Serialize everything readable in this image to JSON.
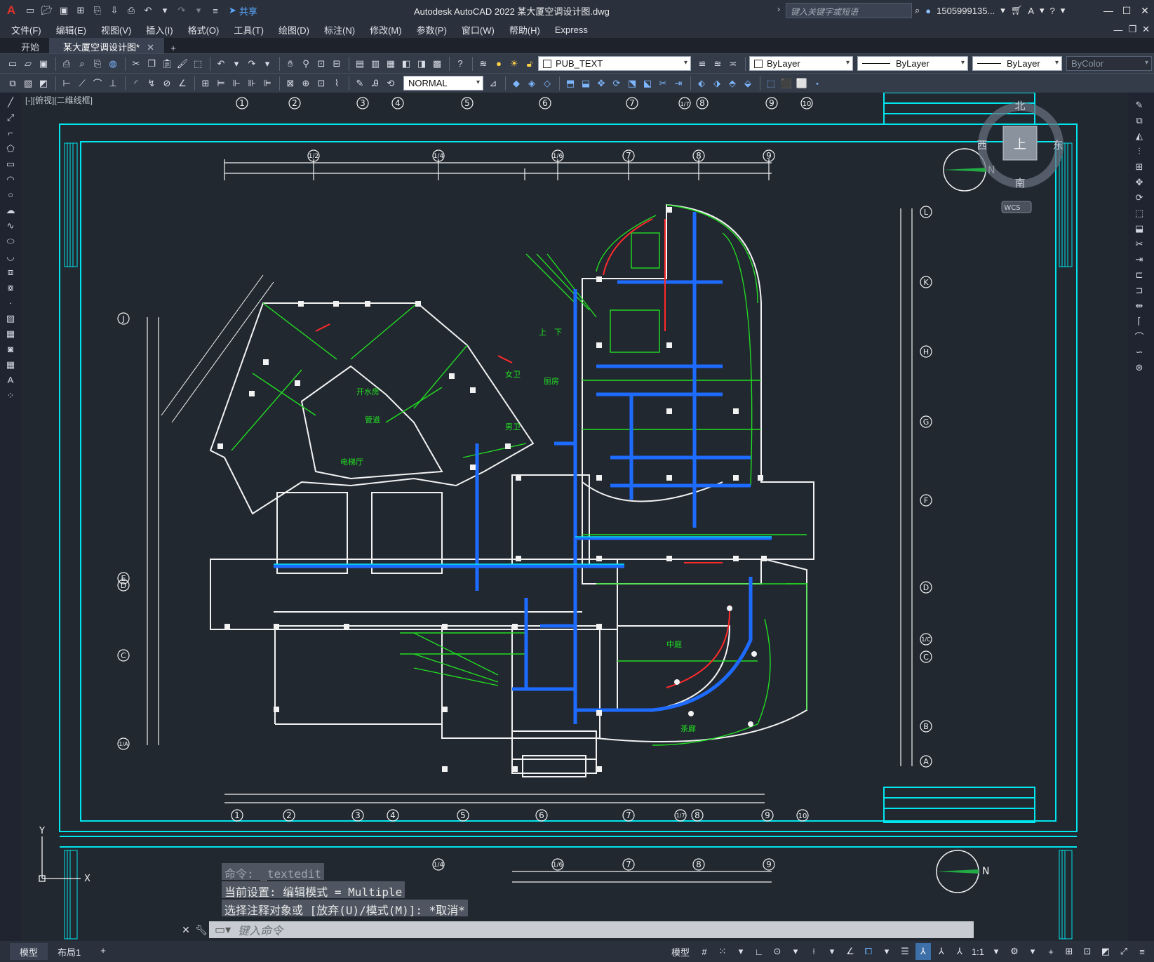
{
  "titlebar": {
    "app_icon": "A",
    "title": "Autodesk AutoCAD 2022    某大厦空调设计图.dwg",
    "share_label": "共享",
    "search_placeholder": "键入关键字或短语",
    "user": "1505999135...",
    "icons": [
      "new-icon",
      "open-icon",
      "save-icon",
      "saveas-icon",
      "publish-icon",
      "plot-icon",
      "undo-icon",
      "redo-icon",
      "share-icon",
      "search-icon",
      "user-icon",
      "cart-icon",
      "autodesk-icon",
      "help-icon"
    ]
  },
  "menubar": {
    "items": [
      "文件(F)",
      "编辑(E)",
      "视图(V)",
      "插入(I)",
      "格式(O)",
      "工具(T)",
      "绘图(D)",
      "标注(N)",
      "修改(M)",
      "参数(P)",
      "窗口(W)",
      "帮助(H)",
      "Express"
    ]
  },
  "filetabs": {
    "tabs": [
      {
        "label": "开始",
        "active": false
      },
      {
        "label": "某大厦空调设计图*",
        "active": true
      }
    ]
  },
  "toolbar1": {
    "layer_name": "PUB_TEXT",
    "color": "ByLayer",
    "linetype": "ByLayer",
    "lineweight": "ByLayer",
    "plotstyle": "ByColor"
  },
  "toolbar2": {
    "style": "NORMAL"
  },
  "viewport": {
    "label": "[-][俯视][二维线框]",
    "viewcube": {
      "top": "上",
      "north": "北",
      "south": "南",
      "east": "东",
      "west": "西",
      "wcs": "WCS",
      "compass_n": "N"
    },
    "ucs": {
      "x": "X",
      "y": "Y"
    }
  },
  "drawing": {
    "top_grid": [
      "1",
      "2",
      "3",
      "4",
      "5",
      "6",
      "7",
      "1/7",
      "8",
      "9",
      "10"
    ],
    "inner_top_grid": [
      "1/2",
      "1/4",
      "1/6",
      "7",
      "8",
      "9"
    ],
    "bottom_grid": [
      "1",
      "2",
      "3",
      "4",
      "5",
      "6",
      "7",
      "1/7",
      "8",
      "9",
      "10"
    ],
    "right_grid": [
      "L",
      "K",
      "H",
      "G",
      "F",
      "D",
      "1/C",
      "C",
      "B",
      "A"
    ],
    "left_grid": [
      "J",
      "E",
      "D",
      "C",
      "1/A"
    ],
    "lower_grid": [
      "1/4",
      "1/6",
      "7",
      "8",
      "9"
    ],
    "north": "N",
    "room_labels": [
      "开水房",
      "管道",
      "电梯厅",
      "上",
      "下",
      "女卫",
      "男卫",
      "厨房",
      "中庭",
      "茶廊"
    ]
  },
  "command": {
    "history": [
      {
        "text": "命令:  _textedit",
        "dim": true
      },
      {
        "text": "当前设置: 编辑模式 = Multiple",
        "dim": false
      },
      {
        "text": "选择注释对象或 [放弃(U)/模式(M)]: *取消*",
        "dim": false
      }
    ],
    "placeholder": "键入命令"
  },
  "statusbar": {
    "tabs": [
      {
        "label": "模型",
        "active": true
      },
      {
        "label": "布局1",
        "active": false
      }
    ],
    "model_label": "模型",
    "scale": "1:1"
  },
  "colors": {
    "cyan": "#00e5ee",
    "green": "#22dd22",
    "blue": "#1e6bff",
    "red": "#ff2a2a",
    "white": "#f2f2f2",
    "background": "#212830"
  }
}
